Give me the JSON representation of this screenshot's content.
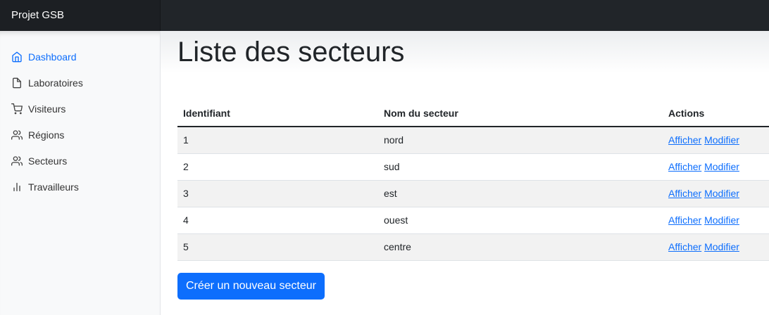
{
  "navbar": {
    "brand": "Projet GSB"
  },
  "sidebar": {
    "items": [
      {
        "label": "Dashboard",
        "icon": "home-icon",
        "active": true
      },
      {
        "label": "Laboratoires",
        "icon": "file-icon"
      },
      {
        "label": "Visiteurs",
        "icon": "shopping-cart-icon"
      },
      {
        "label": "Régions",
        "icon": "users-icon"
      },
      {
        "label": "Secteurs",
        "icon": "users-icon"
      },
      {
        "label": "Travailleurs",
        "icon": "bar-chart-icon"
      }
    ]
  },
  "main": {
    "title": "Liste des secteurs",
    "table": {
      "headers": [
        "Identifiant",
        "Nom du secteur",
        "Actions"
      ],
      "rows": [
        {
          "id": "1",
          "name": "nord"
        },
        {
          "id": "2",
          "name": "sud"
        },
        {
          "id": "3",
          "name": "est"
        },
        {
          "id": "4",
          "name": "ouest"
        },
        {
          "id": "5",
          "name": "centre"
        }
      ],
      "action_view": "Afficher",
      "action_edit": "Modifier"
    },
    "create_button": "Créer un nouveau secteur"
  },
  "colors": {
    "accent": "#0d6efd",
    "navbar": "#212529",
    "sidebar_bg": "#f8f9fa",
    "stripe": "#f2f2f2"
  }
}
